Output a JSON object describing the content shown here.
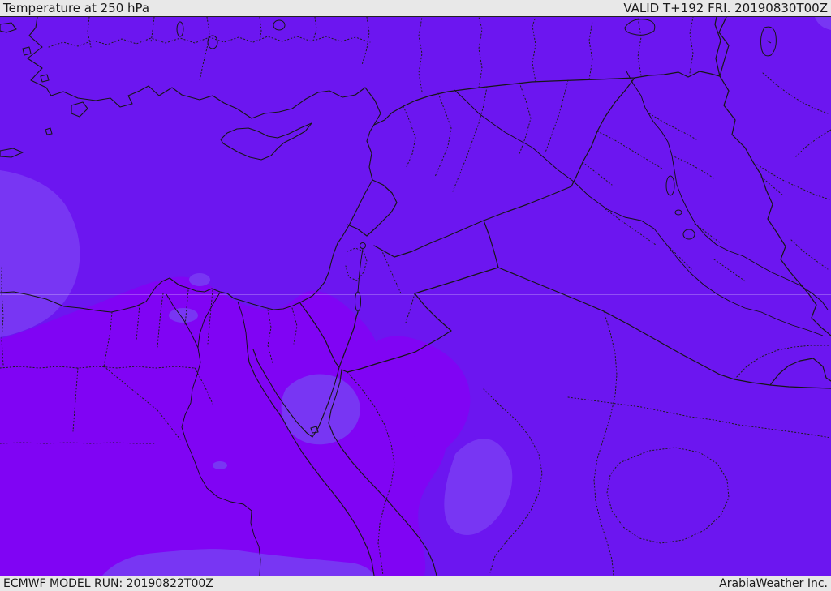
{
  "header": {
    "title": "Temperature at 250 hPa",
    "valid_label": "VALID T+192 FRI. 20190830T00Z"
  },
  "footer": {
    "model_run": "ECMWF MODEL RUN: 20190822T00Z",
    "brand": "ArabiaWeather Inc."
  },
  "map": {
    "region": "Middle East / Eastern Mediterranean",
    "field": "Temperature at 250 hPa (filled contours)",
    "colors": {
      "base_band": "#6C16F0",
      "warm_band": "#8004F4",
      "cool_band": "#7836F3",
      "line": "#161616",
      "admin_line": "#1c1c1c",
      "river_line": "#101010",
      "graticule": "rgba(255,255,255,0.25)",
      "bar_bg": "#e8e8e8",
      "bar_text": "#1a1a1a"
    }
  }
}
